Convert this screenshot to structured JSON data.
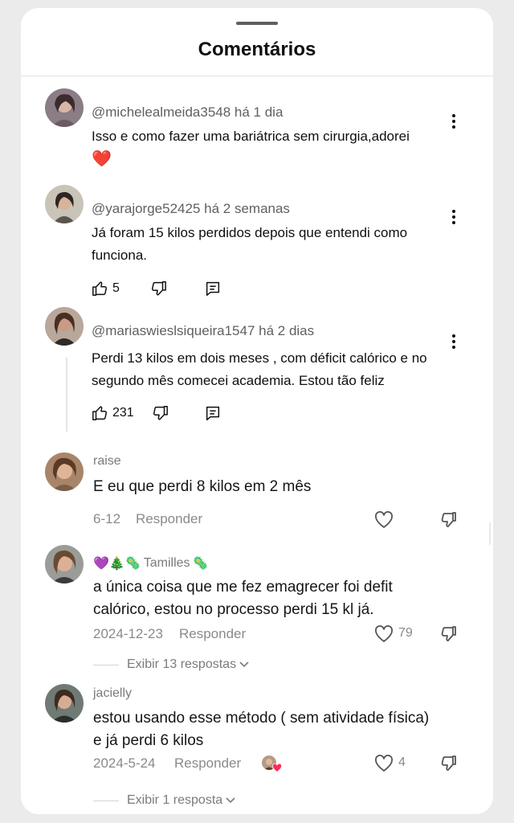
{
  "sheet": {
    "title": "Comentários"
  },
  "comments": [
    {
      "handle": "@michelealmeida3548",
      "time": "há 1 dia",
      "text": "Isso e como fazer uma bariátrica sem cirurgia,adorei",
      "emoji": "❤️"
    },
    {
      "handle": "@yarajorge52425",
      "time": "há 2 semanas",
      "text": "Já foram 15 kilos perdidos depois que entendi como funciona.",
      "likes": "5"
    },
    {
      "handle": "@mariaswieslsiqueira1547",
      "time": "há 2 dias",
      "text": "Perdi 13 kilos em dois meses , com déficit calórico e no segundo mês comecei academia. Estou tão feliz",
      "likes": "231"
    }
  ],
  "replies": [
    {
      "name": "raise",
      "text": "E eu que perdi 8 kilos em 2 mês",
      "date": "6-12",
      "reply_label": "Responder"
    },
    {
      "name_prefix": "💜🎄🦠",
      "name": "Tamilles",
      "name_suffix": "🦠",
      "text": "a única coisa que me fez emagrecer foi defit calórico, estou no processo perdi 15 kl já.",
      "date": "2024-12-23",
      "reply_label": "Responder",
      "likes": "79",
      "view_replies": "Exibir 13 respostas"
    },
    {
      "name": "jacielly",
      "text": "estou usando esse método ( sem atividade física) e já perdi 6 kilos",
      "date": "2024-5-24",
      "reply_label": "Responder",
      "likes": "4",
      "view_replies": "Exibir 1 resposta"
    }
  ],
  "colors": {
    "heart_emoji": "#e0203a",
    "text_primary": "#0f0f0f",
    "text_secondary": "#606060",
    "tiktok_secondary": "#8a8a8a"
  }
}
